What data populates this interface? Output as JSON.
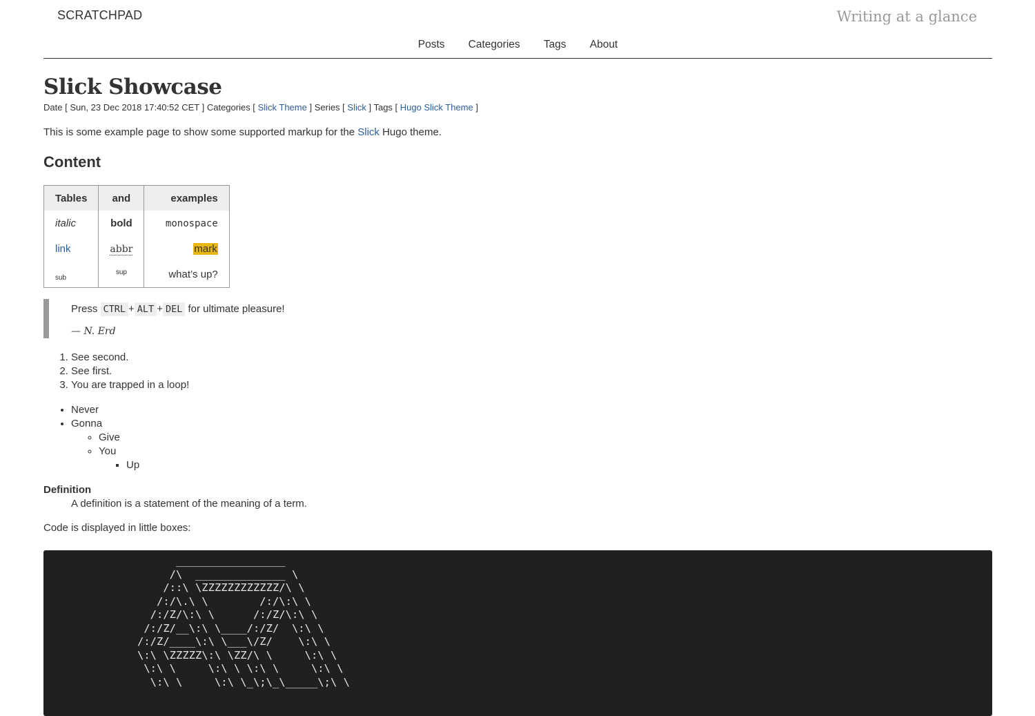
{
  "header": {
    "site_title": "SCRATCHPAD",
    "tagline": "Writing at a glance",
    "nav": [
      "Posts",
      "Categories",
      "Tags",
      "About"
    ]
  },
  "post": {
    "title": "Slick Showcase",
    "meta": {
      "date_label": "Date [",
      "date": "Sun, 23 Dec 2018 17:40:52 CET",
      "categories_label": "] Categories [",
      "category": "Slick Theme",
      "series_label": "] Series [",
      "series": "Slick",
      "tags_label": "] Tags [",
      "tag": "Hugo Slick Theme",
      "close": "]"
    },
    "intro_before": "This is some example page to show some supported markup for the ",
    "intro_link": "Slick",
    "intro_after": " Hugo theme."
  },
  "content": {
    "heading": "Content",
    "table": {
      "headers": [
        "Tables",
        "and",
        "examples"
      ],
      "row1": [
        "italic",
        "bold",
        "monospace"
      ],
      "row2": [
        "link",
        "abbr",
        "mark"
      ],
      "row3": [
        "sub",
        "sup",
        "what’s up?"
      ]
    },
    "quote": {
      "before": "Press ",
      "keys": [
        "CTRL",
        "ALT",
        "DEL"
      ],
      "after": " for ultimate pleasure!",
      "cite": "— N. Erd"
    },
    "ordered": [
      "See second.",
      "See first.",
      "You are trapped in a loop!"
    ],
    "unordered": {
      "never": "Never",
      "gonna": "Gonna",
      "give": "Give",
      "you": "You",
      "up": "Up"
    },
    "definition": {
      "term": "Definition",
      "desc": "A definition is a statement of the meaning of a term."
    },
    "code_intro": "Code is displayed in little boxes:",
    "code": "            _________________\n           /\\  ______________ \\\n          /::\\ \\ZZZZZZZZZZZZ/\\ \\\n         /:/\\.\\ \\        /:/\\:\\ \\\n        /:/Z/\\:\\ \\      /:/Z/\\:\\ \\\n       /:/Z/__\\:\\ \\____/:/Z/  \\:\\ \\\n      /:/Z/____\\:\\ \\___\\/Z/    \\:\\ \\\n      \\:\\ \\ZZZZZ\\:\\ \\ZZ/\\ \\     \\:\\ \\\n       \\:\\ \\     \\:\\ \\ \\:\\ \\     \\:\\ \\\n        \\:\\ \\     \\:\\ \\_\\;\\_\\_____\\;\\ \\"
  }
}
